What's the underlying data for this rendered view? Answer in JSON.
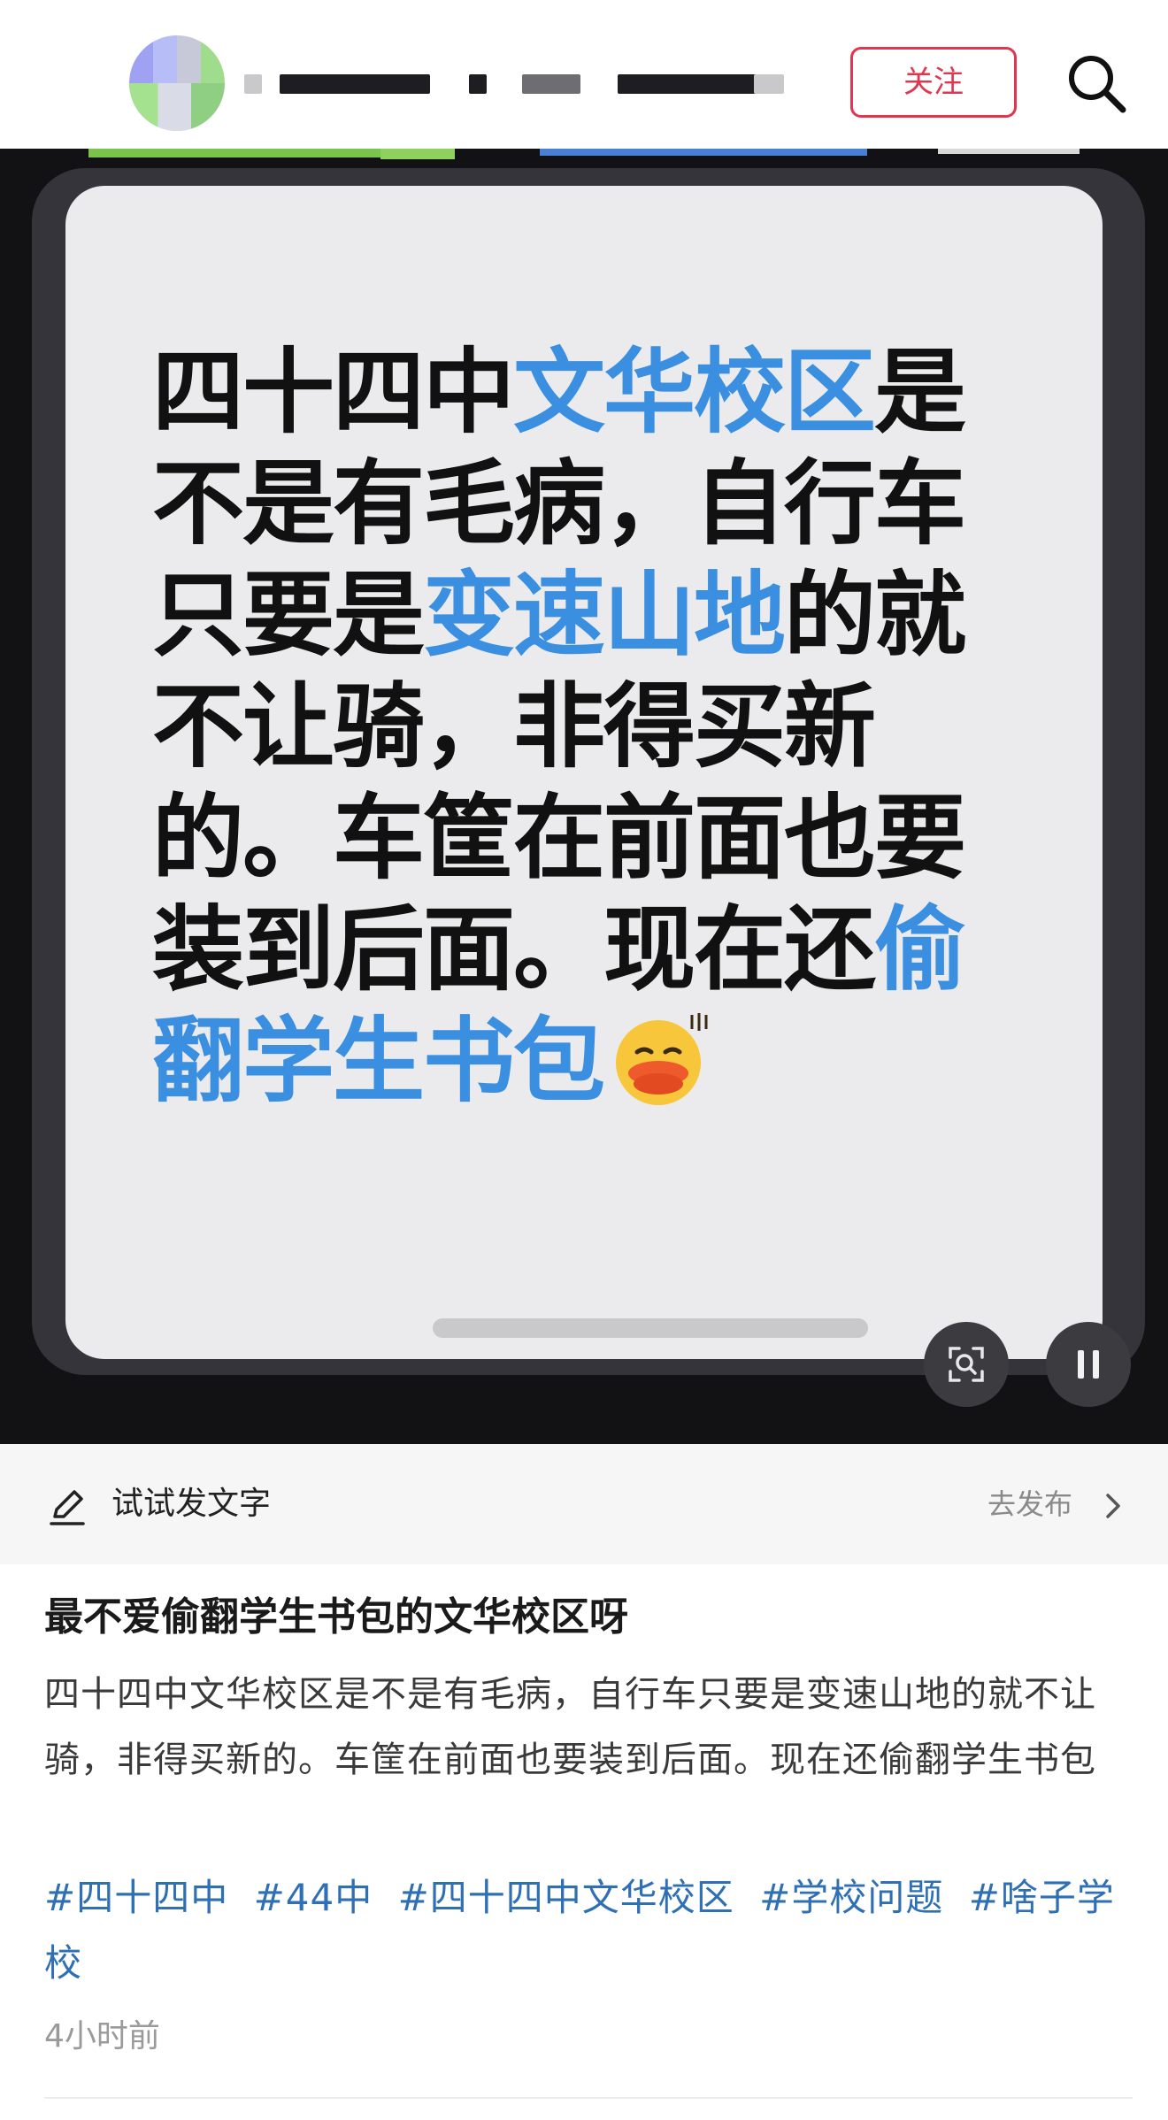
{
  "header": {
    "follow_label": "关注"
  },
  "content": {
    "lines": [
      [
        {
          "t": "四十四中",
          "h": false
        },
        {
          "t": "文华校区",
          "h": true
        },
        {
          "t": "是",
          "h": false
        }
      ],
      [
        {
          "t": "不是有毛病，自行车",
          "h": false
        }
      ],
      [
        {
          "t": "只要是",
          "h": false
        },
        {
          "t": "变速山地",
          "h": true
        },
        {
          "t": "的就",
          "h": false
        }
      ],
      [
        {
          "t": "不让骑，非得买新",
          "h": false
        }
      ],
      [
        {
          "t": "的。车筐在前面也要",
          "h": false
        }
      ],
      [
        {
          "t": "装到后面。现在还",
          "h": false
        },
        {
          "t": "偷",
          "h": true
        }
      ],
      [
        {
          "t": "翻学生书包",
          "h": true
        }
      ]
    ],
    "highlight_color": "#3a8fe0",
    "emoji": "pouting-face-emoji"
  },
  "compose": {
    "hint": "试试发文字",
    "go_label": "去发布"
  },
  "post": {
    "title": "最不爱偷翻学生书包的文华校区呀",
    "body": "四十四中文华校区是不是有毛病，自行车只要是变速山地的就不让骑，非得买新的。车筐在前面也要装到后面。现在还偷翻学生书包",
    "tags": [
      "#四十四中",
      "#44中",
      "#四十四中文华校区",
      "#学校问题",
      "#啥子学校"
    ],
    "time": "4小时前"
  },
  "colors": {
    "accent": "#e0364f",
    "tag": "#2f6fb4",
    "video_bg": "#121214"
  }
}
